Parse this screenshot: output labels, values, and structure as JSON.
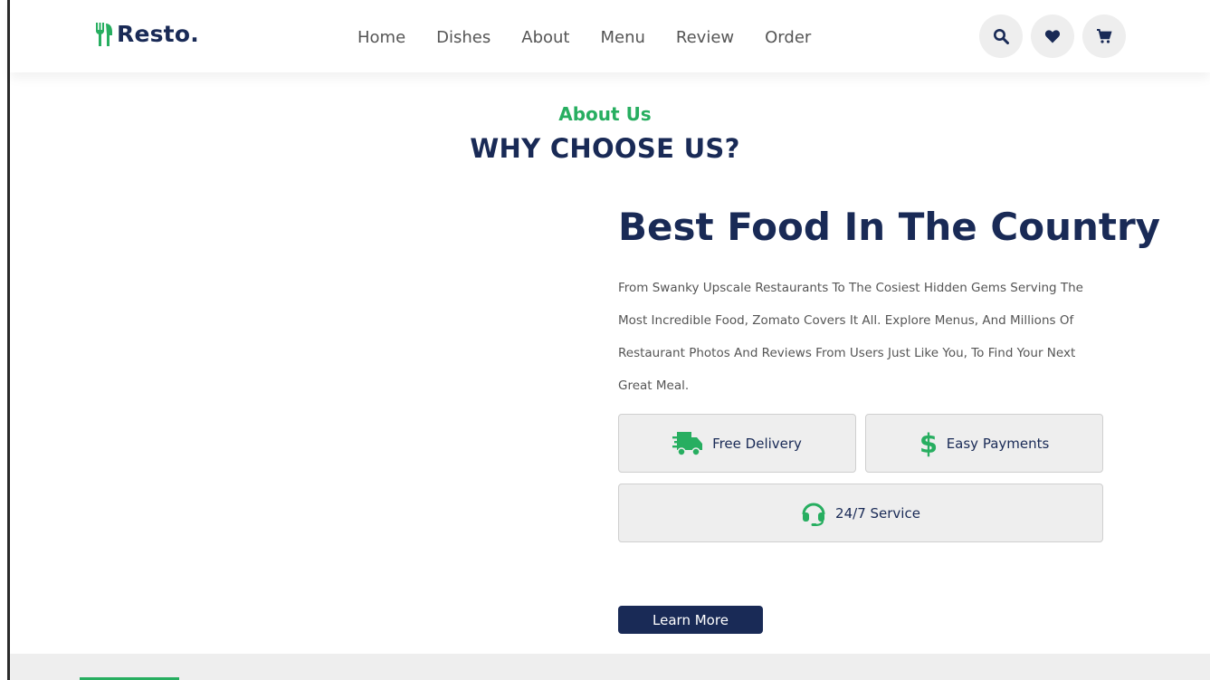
{
  "header": {
    "logo_text": "Resto.",
    "nav": [
      "Home",
      "Dishes",
      "About",
      "Menu",
      "Review",
      "Order"
    ],
    "icons": [
      "search-icon",
      "heart-icon",
      "cart-icon"
    ]
  },
  "about": {
    "sub_heading": "About Us",
    "heading": "WHY CHOOSE US?",
    "title": "Best Food In The Country",
    "description": "From Swanky Upscale Restaurants To The Cosiest Hidden Gems Serving The Most Incredible Food, Zomato Covers It All. Explore Menus, And Millions Of Restaurant Photos And Reviews From Users Just Like You, To Find Your Next Great Meal.",
    "features": [
      {
        "label": "Free Delivery",
        "icon": "truck-icon"
      },
      {
        "label": "Easy Payments",
        "icon": "dollar-icon"
      },
      {
        "label": "24/7 Service",
        "icon": "headset-icon"
      }
    ],
    "button_label": "Learn More"
  },
  "colors": {
    "brand_green": "#27ae60",
    "navy": "#192a56",
    "light_gray": "#eeeeee"
  }
}
